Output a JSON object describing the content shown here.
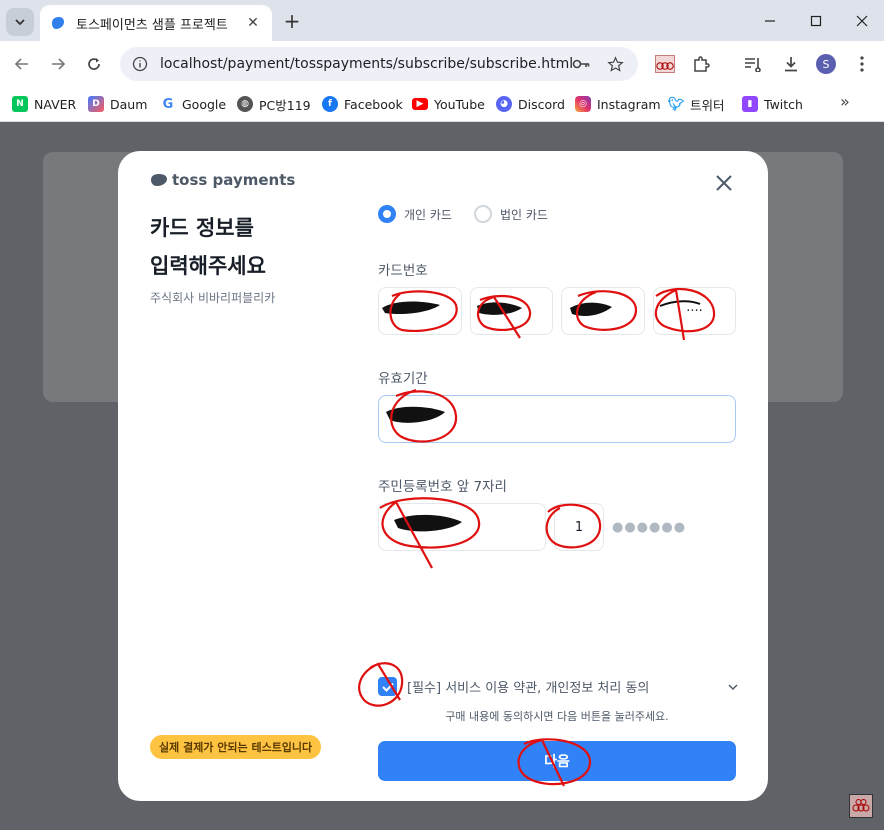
{
  "browser": {
    "tab_title": "토스페이먼츠 샘플 프로젝트",
    "url": "localhost/payment/tosspayments/subscribe/subscribe.html",
    "profile_initial": "S"
  },
  "bookmarks": [
    "NAVER",
    "Daum",
    "Google",
    "PC방119",
    "Facebook",
    "YouTube",
    "Discord",
    "Instagram",
    "트위터",
    "Twitch"
  ],
  "modal": {
    "brand": "toss payments",
    "heading_line1": "카드 정보를",
    "heading_line2": "입력해주세요",
    "company": "주식회사 비바리퍼블리카",
    "test_badge": "실제 결제가 안되는 테스트입니다",
    "card_type": {
      "personal": "개인 카드",
      "corporate": "법인 카드",
      "selected": "personal"
    },
    "card_number_label": "카드번호",
    "card_number_last": "····",
    "expiry_label": "유효기간",
    "rrn_label": "주민등록번호 앞 7자리",
    "rrn_gender_digit": "1",
    "rrn_mask": "●●●●●●",
    "agree_text": "[필수] 서비스 이용 약관, 개인정보 처리 동의",
    "agree_checked": true,
    "hint": "구매 내용에 동의하시면 다음 버튼을 눌러주세요.",
    "next_button": "다음"
  },
  "colors": {
    "accent": "#3182f6",
    "badge": "#ffc342",
    "annotation": "#e01010"
  }
}
